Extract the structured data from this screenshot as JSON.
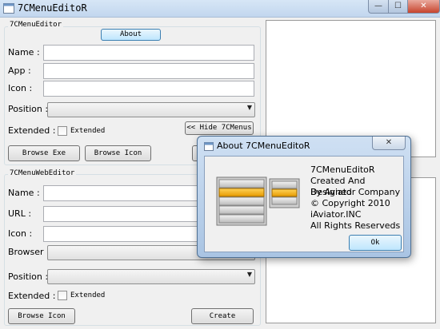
{
  "window": {
    "title": "7CMenuEditoR",
    "minimize": "—",
    "maximize": "☐",
    "close": "✕"
  },
  "menu_editor": {
    "group_label": "7CMenuEditor",
    "about_button": "About",
    "name_label": "Name :",
    "app_label": "App :",
    "icon_label": "Icon :",
    "position_label": "Position :",
    "extended_label": "Extended :",
    "extended_checkbox": "Extended",
    "hide_button": "<< Hide 7CMenus",
    "browse_exe_button": "Browse Exe",
    "browse_icon_button": "Browse Icon"
  },
  "web_editor": {
    "group_label": "7CMenuWebEditor",
    "name_label": "Name :",
    "url_label": "URL :",
    "icon_label": "Icon :",
    "browser_label": "Browser :",
    "position_label": "Position :",
    "extended_label": "Extended :",
    "extended_checkbox": "Extended",
    "browse_icon_button": "Browse Icon",
    "create_button": "Create"
  },
  "about_dialog": {
    "title": "About 7CMenuEditoR",
    "close": "✕",
    "lines": [
      "7CMenuEditoR",
      "Created And Designed",
      "By Aviator Company",
      "© Copyright 2010",
      "iAviator.INC",
      "All Rights Reserveds"
    ],
    "ok_button": "Ok"
  },
  "icons": {
    "app": "window-icon",
    "combo_arrow": "chevron-down-icon",
    "logo": "menu-logo-icon"
  },
  "colors": {
    "highlight": "#f0a30a",
    "title_bar": "#c2d6ee",
    "close_red": "#c7442d"
  }
}
